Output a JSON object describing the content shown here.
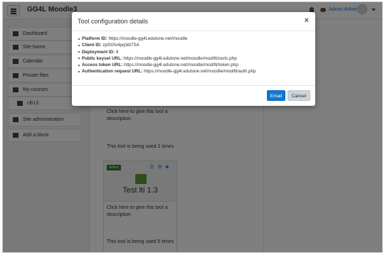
{
  "navbar": {
    "site_name": "GG4L Moodle3",
    "user_name": "Admin Admin"
  },
  "drawer": {
    "items": [
      {
        "label": "Dashboard",
        "icon": "dashboard-icon"
      },
      {
        "label": "Site home",
        "icon": "home-icon"
      },
      {
        "label": "Calendar",
        "icon": "calendar-icon"
      },
      {
        "label": "Private files",
        "icon": "file-icon"
      },
      {
        "label": "My courses",
        "icon": "graduation-cap-icon"
      },
      {
        "label": "clti13",
        "icon": "graduation-cap-icon"
      },
      {
        "label": "Site administration",
        "icon": "wrench-icon"
      },
      {
        "label": "Add a block",
        "icon": "plus-square-icon"
      }
    ]
  },
  "tools": [
    {
      "desc": "Click here to give this tool a description",
      "usage": "This tool is being used 2 times"
    },
    {
      "badge": "Active",
      "name": "Test lti 1.3",
      "desc": "Click here to give this tool a description",
      "usage": "This tool is being used 5 times"
    }
  ],
  "modal": {
    "title": "Tool configuration details",
    "close": "×",
    "details": [
      {
        "label": "Platform ID:",
        "value": "https://moodle-gg4l.edutone.net/moodle"
      },
      {
        "label": "Client ID:",
        "value": "zpSGIv4pq3di7SA"
      },
      {
        "label": "Deployment ID:",
        "value": "8"
      },
      {
        "label": "Public keyset URL:",
        "value": "https://moodle-gg4l.edutone.net/moodle/mod/lti/certs.php"
      },
      {
        "label": "Access token URL:",
        "value": "https://moodle-gg4l.edutone.net/moodle/mod/lti/token.php"
      },
      {
        "label": "Authentication request URL:",
        "value": "https://moodle-gg4l.edutone.net/moodle/mod/lti/auth.php"
      }
    ],
    "email_label": "Email",
    "cancel_label": "Cancel"
  },
  "colors": {
    "primary": "#1177d1",
    "active_badge": "#357a32",
    "overlay": "rgba(0,0,0,0.5)"
  }
}
